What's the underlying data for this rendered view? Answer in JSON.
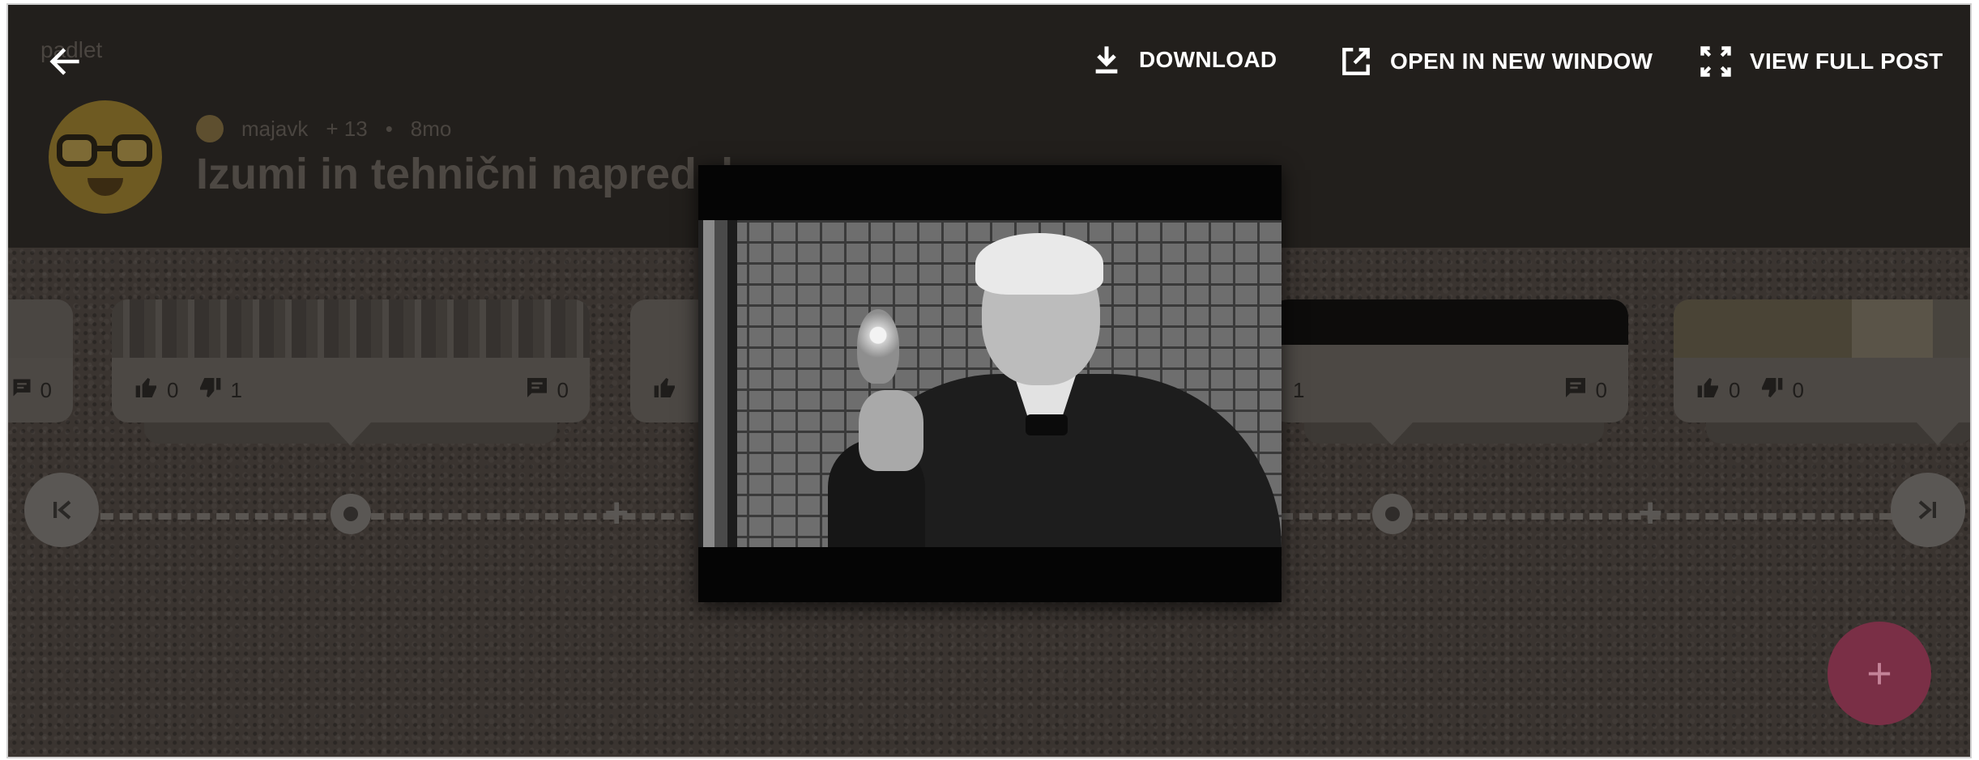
{
  "app": {
    "name": "padlet"
  },
  "post": {
    "author": "majavk",
    "score": "+ 13",
    "age": "8mo",
    "title": "Izumi in tehnični napredek"
  },
  "topbar": {
    "download_label": "DOWNLOAD",
    "open_new_window_label": "OPEN IN NEW WINDOW",
    "view_full_post_label": "VIEW FULL POST"
  },
  "cards": [
    {
      "likes": "",
      "dislikes": "",
      "comments": "0"
    },
    {
      "likes": "0",
      "dislikes": "1",
      "comments": "0"
    },
    {
      "likes": "",
      "dislikes": "",
      "comments": ""
    },
    {
      "likes": "",
      "dislikes": "1",
      "comments": "0"
    },
    {
      "likes": "0",
      "dislikes": "0",
      "comments": ""
    }
  ],
  "fab": {
    "label": "+"
  },
  "colors": {
    "overlay": "#1b1917",
    "fab": "#7a2f46",
    "text_on_overlay": "#ffffff"
  },
  "icons": [
    "back-arrow-icon",
    "download-icon",
    "open-external-icon",
    "fullscreen-icon",
    "thumbs-up-icon",
    "thumbs-down-icon",
    "comment-icon",
    "first-page-icon",
    "last-page-icon",
    "plus-icon"
  ]
}
